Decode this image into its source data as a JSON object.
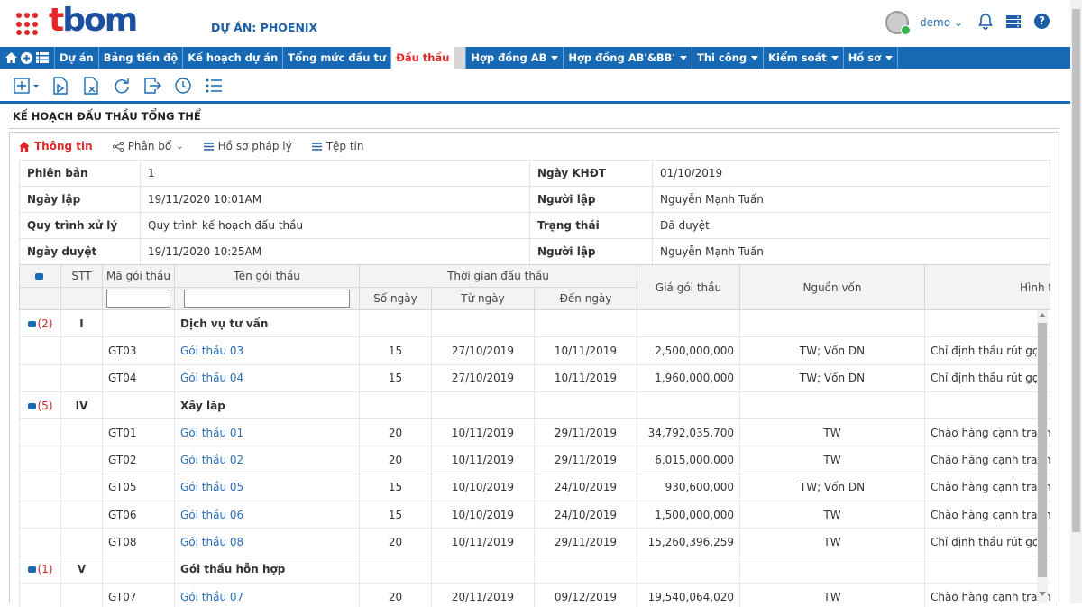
{
  "header": {
    "logo_text_t": "t",
    "logo_text_rest": "bom",
    "project": "DỰ ÁN: PHOENIX",
    "user": "demo ⌄",
    "help": "?"
  },
  "nav": {
    "items": [
      {
        "label": "Dự án",
        "dropdown": false
      },
      {
        "label": "Bảng tiến độ",
        "dropdown": false
      },
      {
        "label": "Kế hoạch dự án",
        "dropdown": false
      },
      {
        "label": "Tổng mức đầu tư",
        "dropdown": false
      },
      {
        "label": "Đấu thầu",
        "dropdown": false,
        "active": true
      },
      {
        "label": "Hợp đồng AB",
        "dropdown": true
      },
      {
        "label": "Hợp đồng AB'&BB'",
        "dropdown": true
      },
      {
        "label": "Thi công",
        "dropdown": true
      },
      {
        "label": "Kiểm soát",
        "dropdown": true
      },
      {
        "label": "Hồ sơ",
        "dropdown": true
      }
    ]
  },
  "toolbar": {
    "icons": [
      "add-dropdown-icon",
      "edit-document-icon",
      "delete-document-icon",
      "refresh-icon",
      "export-icon",
      "history-icon",
      "list-icon"
    ]
  },
  "page_title": "KẾ HOẠCH ĐẤU THẦU TỔNG THỂ",
  "tabs": [
    {
      "label": "Thông tin",
      "icon": "home-icon"
    },
    {
      "label": "Phân bổ",
      "icon": "share-icon"
    },
    {
      "label": "Hồ sơ pháp lý",
      "icon": "menu-icon"
    },
    {
      "label": "Tệp tin",
      "icon": "menu-icon"
    }
  ],
  "info": [
    [
      "Phiên bản",
      "1",
      "Ngày KHĐT",
      "01/10/2019"
    ],
    [
      "Ngày lập",
      "19/11/2020 10:01AM",
      "Người lập",
      "Nguyễn Mạnh Tuấn"
    ],
    [
      "Quy trình xử lý",
      "Quy trình kế hoạch đấu thầu",
      "Trạng thái",
      "Đã duyệt"
    ],
    [
      "Ngày duyệt",
      "19/11/2020 10:25AM",
      "Người lập",
      "Nguyễn Mạnh Tuấn"
    ]
  ],
  "grid": {
    "headers": {
      "stt": "STT",
      "code": "Mã gói thầu",
      "name": "Tên gói thầu",
      "time": "Thời gian đấu thầu",
      "days": "Số ngày",
      "from": "Từ ngày",
      "to": "Đến ngày",
      "price": "Giá gói thầu",
      "source": "Nguồn vốn",
      "method": "Hình thức lựa"
    },
    "rows": [
      {
        "group": true,
        "count": "(2)",
        "stt": "I",
        "name": "Dịch vụ tư vấn"
      },
      {
        "code": "GT03",
        "name": "Gói thầu 03",
        "days": "15",
        "from": "27/10/2019",
        "to": "10/11/2019",
        "price": "2,500,000,000",
        "source": "TW; Vốn DN",
        "method": "Chỉ định thầu rút gọn"
      },
      {
        "code": "GT04",
        "name": "Gói thầu 04",
        "days": "15",
        "from": "27/10/2019",
        "to": "10/11/2019",
        "price": "1,960,000,000",
        "source": "TW; Vốn DN",
        "method": "Chỉ định thầu rút gọn"
      },
      {
        "group": true,
        "count": "(5)",
        "stt": "IV",
        "name": "Xây lắp"
      },
      {
        "code": "GT01",
        "name": "Gói thầu 01",
        "days": "20",
        "from": "10/11/2019",
        "to": "29/11/2019",
        "price": "34,792,035,700",
        "source": "TW",
        "method": "Chào hàng cạnh tranh"
      },
      {
        "code": "GT02",
        "name": "Gói thầu 02",
        "days": "20",
        "from": "10/11/2019",
        "to": "29/11/2019",
        "price": "6,015,000,000",
        "source": "TW",
        "method": "Chào hàng cạnh tranh"
      },
      {
        "code": "GT05",
        "name": "Gói thầu 05",
        "days": "15",
        "from": "10/10/2019",
        "to": "24/10/2019",
        "price": "930,600,000",
        "source": "TW; Vốn DN",
        "method": "Chào hàng cạnh tranh"
      },
      {
        "code": "GT06",
        "name": "Gói thầu 06",
        "days": "15",
        "from": "10/10/2019",
        "to": "24/10/2019",
        "price": "1,500,000,000",
        "source": "TW",
        "method": "Chào hàng cạnh tranh"
      },
      {
        "code": "GT08",
        "name": "Gói thầu 08",
        "days": "20",
        "from": "10/11/2019",
        "to": "29/11/2019",
        "price": "15,260,396,259",
        "source": "TW",
        "method": "Chỉ định thầu rút gọn"
      },
      {
        "group": true,
        "count": "(1)",
        "stt": "V",
        "name": "Gói thầu hỗn hợp"
      },
      {
        "code": "GT07",
        "name": "Gói thầu 07",
        "days": "20",
        "from": "20/11/2019",
        "to": "09/12/2019",
        "price": "19,540,064,020",
        "source": "TW",
        "method": "Chào hàng cạnh tranh"
      }
    ]
  },
  "colors": {
    "brand_blue": "#1769b4",
    "brand_red": "#e52629"
  }
}
